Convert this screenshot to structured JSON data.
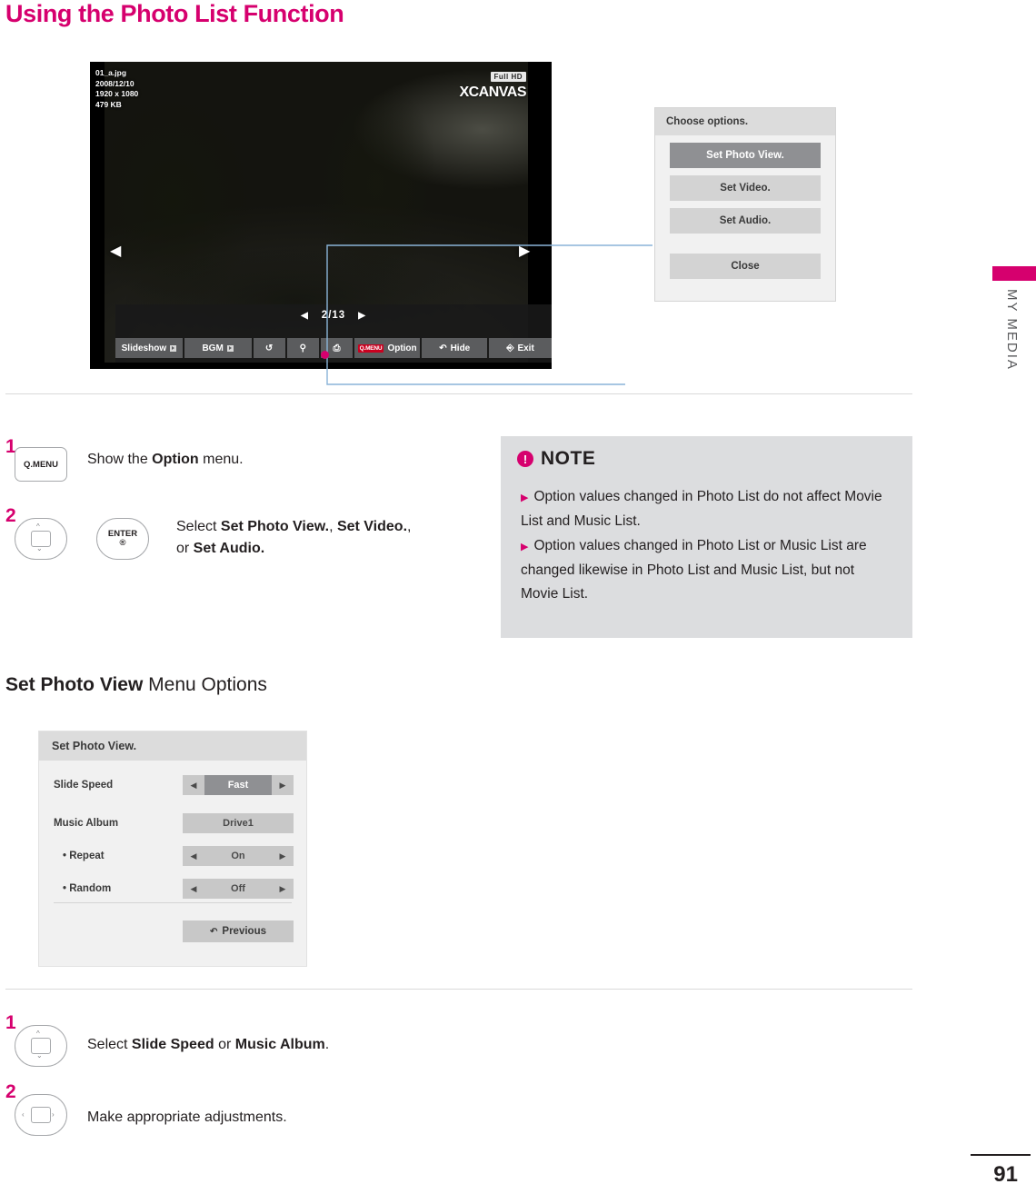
{
  "page": {
    "title": "Using the Photo List Function",
    "number": "91",
    "side_label": "MY MEDIA"
  },
  "tv": {
    "file_info": [
      "01_a.jpg",
      "2008/12/10",
      "1920 x 1080",
      "479 KB"
    ],
    "brand_hd": "Full HD",
    "brand_name": "XCANVAS",
    "counter": "2/13",
    "arrow_left": "◀",
    "arrow_right": "▶",
    "osd_buttons": [
      {
        "label": "Slideshow",
        "icon": "play-square-icon"
      },
      {
        "label": "BGM",
        "icon": "play-square-icon"
      },
      {
        "label": "",
        "icon": "rotate-icon"
      },
      {
        "label": "",
        "icon": "zoom-icon"
      },
      {
        "label": "",
        "icon": "aspect-icon"
      },
      {
        "label": "Option",
        "icon": "qmenu-chip"
      },
      {
        "label": "Hide",
        "icon": "back-icon"
      },
      {
        "label": "Exit",
        "icon": "exit-icon"
      }
    ]
  },
  "options_popup": {
    "title": "Choose options.",
    "items": [
      {
        "label": "Set Photo View.",
        "selected": true
      },
      {
        "label": "Set Video.",
        "selected": false
      },
      {
        "label": "Set Audio.",
        "selected": false
      }
    ],
    "close_label": "Close"
  },
  "steps_top": [
    {
      "num": "1",
      "key": "Q.MENU",
      "text_parts": [
        {
          "t": "Show the ",
          "b": false
        },
        {
          "t": "Option",
          "b": true
        },
        {
          "t": " menu.",
          "b": false
        }
      ]
    },
    {
      "num": "2",
      "key_nav": "nav-updown-icon",
      "key_enter_label": "ENTER",
      "key_enter_symbol": "®",
      "text_parts": [
        {
          "t": "Select ",
          "b": false
        },
        {
          "t": "Set Photo View.",
          "b": true
        },
        {
          "t": ", ",
          "b": false
        },
        {
          "t": "Set Video.",
          "b": true
        },
        {
          "t": ",",
          "b": false
        }
      ],
      "text_parts2": [
        {
          "t": "or ",
          "b": false
        },
        {
          "t": "Set Audio.",
          "b": true
        }
      ]
    }
  ],
  "note": {
    "title": "NOTE",
    "bang": "!",
    "items": [
      "Option values changed in Photo List do not affect Movie List and Music List.",
      "Option values changed in Photo List or Music List are changed likewise in Photo List and Music List, but not Movie List."
    ]
  },
  "section": {
    "bold": "Set Photo View",
    "rest": " Menu Options"
  },
  "set_photo_view": {
    "title": "Set Photo View.",
    "rows": [
      {
        "label": "Slide Speed",
        "value": "Fast",
        "arrows": true,
        "highlight": true
      },
      {
        "label": "Music Album",
        "value": "Drive1",
        "arrows": false,
        "highlight": false
      },
      {
        "label": "• Repeat",
        "value": "On",
        "arrows": true,
        "highlight": false,
        "sub": true
      },
      {
        "label": "• Random",
        "value": "Off",
        "arrows": true,
        "highlight": false,
        "sub": true
      }
    ],
    "previous_label": "Previous",
    "arrow_left": "◀",
    "arrow_right": "▶"
  },
  "steps_bottom": [
    {
      "num": "1",
      "key_nav": "nav-updown-icon",
      "text_parts": [
        {
          "t": "Select ",
          "b": false
        },
        {
          "t": "Slide Speed",
          "b": true
        },
        {
          "t": " or ",
          "b": false
        },
        {
          "t": "Music Album",
          "b": true
        },
        {
          "t": ".",
          "b": false
        }
      ]
    },
    {
      "num": "2",
      "key_nav": "nav-leftright-icon",
      "text_parts": [
        {
          "t": "Make appropriate adjustments.",
          "b": false
        }
      ]
    }
  ],
  "colors": {
    "accent": "#d6006e",
    "note_bg": "#dcdddf",
    "menu_bg": "#f1f1f1",
    "menu_head": "#dcdcdc",
    "menu_sel": "#8f9093"
  }
}
